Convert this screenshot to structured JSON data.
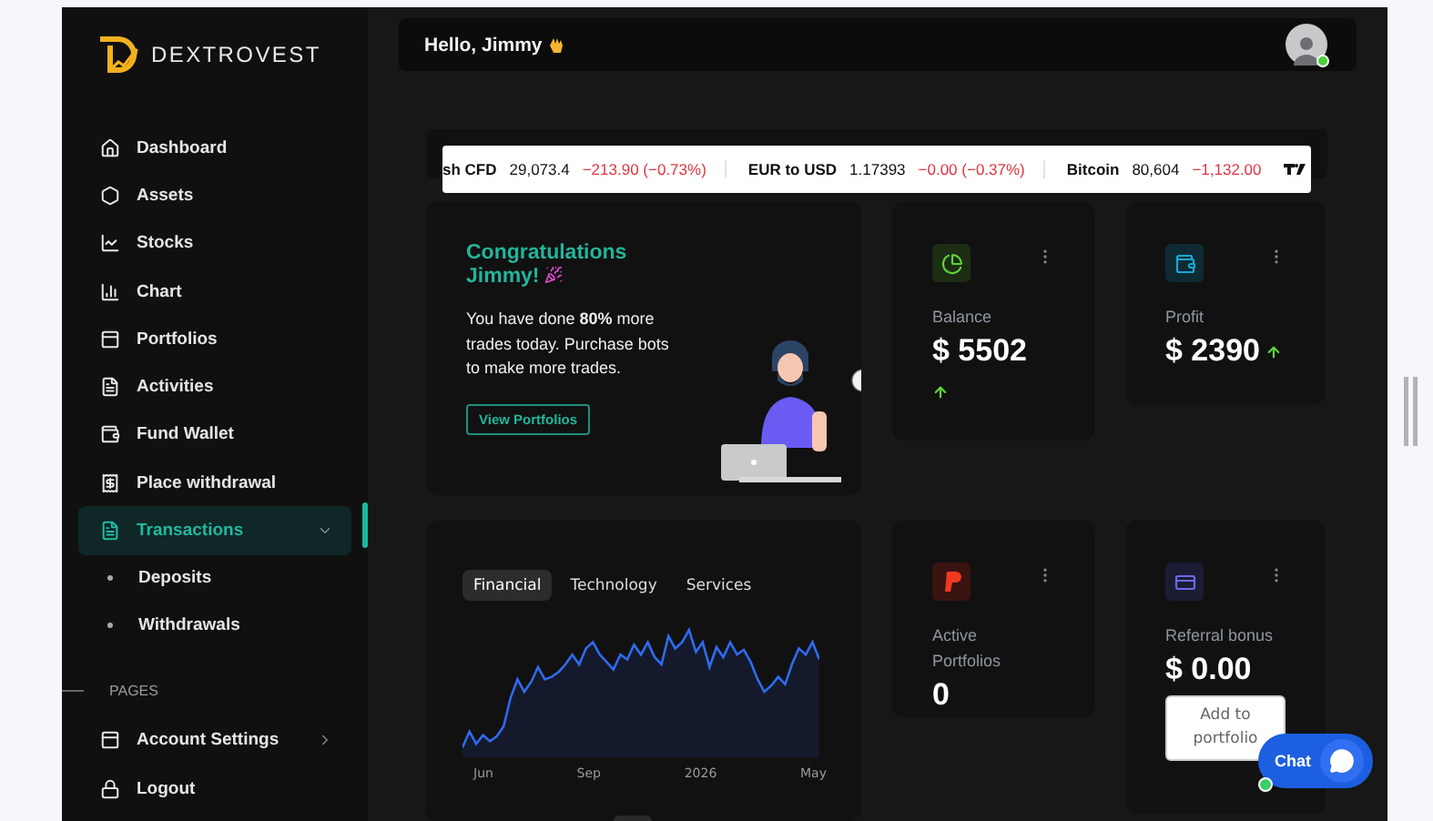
{
  "brand": {
    "name": "DEXTROVEST"
  },
  "sidebar": {
    "items": [
      {
        "label": "Dashboard",
        "selected": false
      },
      {
        "label": "Assets",
        "selected": false
      },
      {
        "label": "Stocks",
        "selected": false
      },
      {
        "label": "Chart",
        "selected": false
      },
      {
        "label": "Portfolios",
        "selected": false
      },
      {
        "label": "Activities",
        "selected": false
      },
      {
        "label": "Fund Wallet",
        "selected": false
      },
      {
        "label": "Place withdrawal",
        "selected": false
      },
      {
        "label": "Transactions",
        "selected": true,
        "expanded": true,
        "children": [
          {
            "label": "Deposits",
            "selected": false
          },
          {
            "label": "Withdrawals",
            "selected": false
          }
        ]
      }
    ],
    "section": "PAGES",
    "page_items": [
      {
        "label": "Account Settings",
        "selected": false,
        "expanded": false
      },
      {
        "label": "Logout",
        "selected": false
      }
    ]
  },
  "header": {
    "greeting": "Hello, Jimmy",
    "avatar": {
      "online": true
    }
  },
  "ticker": [
    {
      "name": "sh CFD",
      "price": "29,073.4",
      "change": "−213.90 (−0.73%)"
    },
    {
      "name": "EUR to USD",
      "price": "1.17393",
      "change": "−0.00 (−0.37%)"
    },
    {
      "name": "Bitcoin",
      "price": "80,604",
      "change": "−1,132.00"
    }
  ],
  "welcome": {
    "title": "Congratulations Jimmy!",
    "message": "You have done **80%** more trades today. Purchase bots to make more trades.",
    "button": "View Portfolios"
  },
  "stats": [
    {
      "label": "Balance",
      "value": "$ 5502",
      "rising": true,
      "trend_inline": false
    },
    {
      "label": "Profit",
      "value": "$ 2390",
      "rising": true,
      "trend_inline": true
    },
    {
      "label": "Active Portfolios",
      "value": "0"
    },
    {
      "label": "Referral bonus",
      "value": "$ 0.00",
      "button": "Add to portfolio"
    }
  ],
  "chart": {
    "tabs": [
      {
        "label": "Financial",
        "selected": true
      },
      {
        "label": "Technology",
        "selected": false
      },
      {
        "label": "Services",
        "selected": false
      }
    ],
    "x_labels": [
      "Jun",
      "Sep",
      "2026",
      "May"
    ]
  },
  "chat": {
    "label": "Chat",
    "online": true
  }
}
